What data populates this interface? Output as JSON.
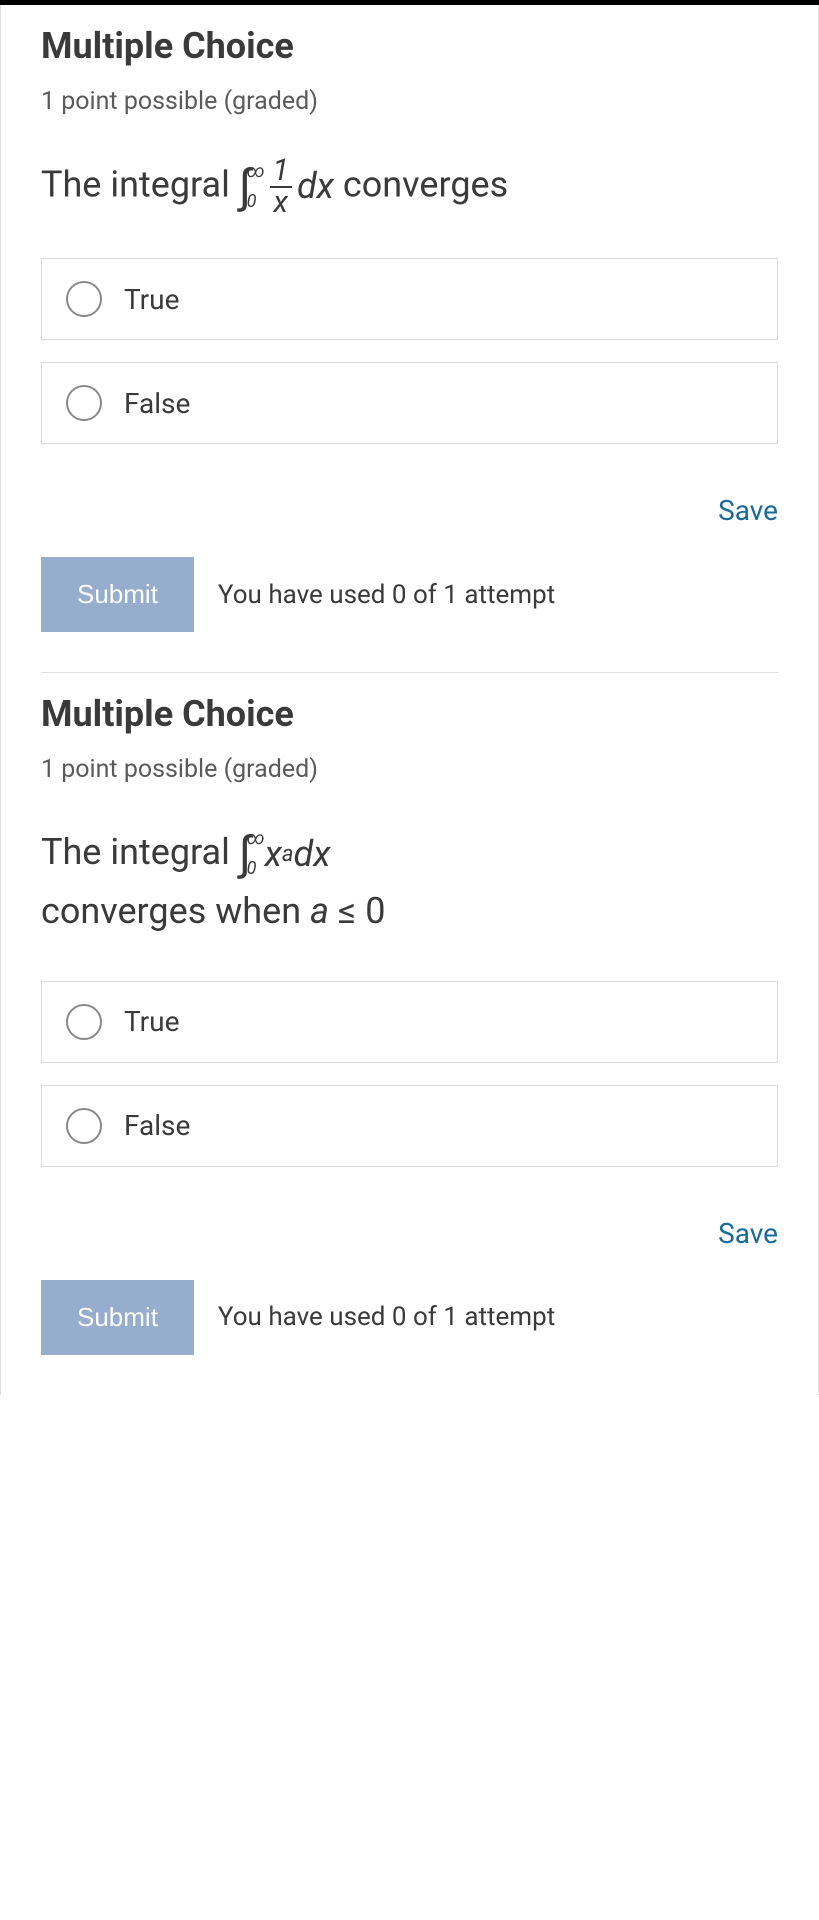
{
  "problems": [
    {
      "heading": "Multiple Choice",
      "subhead": "1 point possible (graded)",
      "question_parts": {
        "prefix": "The integral ",
        "int_upper": "∞",
        "int_lower": "0",
        "frac_num": "1",
        "frac_den": "x",
        "dx": "dx",
        "suffix": " converges"
      },
      "options": [
        "True",
        "False"
      ],
      "save": "Save",
      "submit": "Submit",
      "attempts": "You have used 0 of 1 attempt"
    },
    {
      "heading": "Multiple Choice",
      "subhead": "1 point possible (graded)",
      "question_parts": {
        "prefix": "The integral ",
        "int_upper": "∞",
        "int_lower": "0",
        "base": "x",
        "exp": "a",
        "dx": "dx",
        "line2_a": "converges when ",
        "line2_b": "a",
        "line2_c": " ≤ 0"
      },
      "options": [
        "True",
        "False"
      ],
      "save": "Save",
      "submit": "Submit",
      "attempts": "You have used 0 of 1 attempt"
    }
  ]
}
